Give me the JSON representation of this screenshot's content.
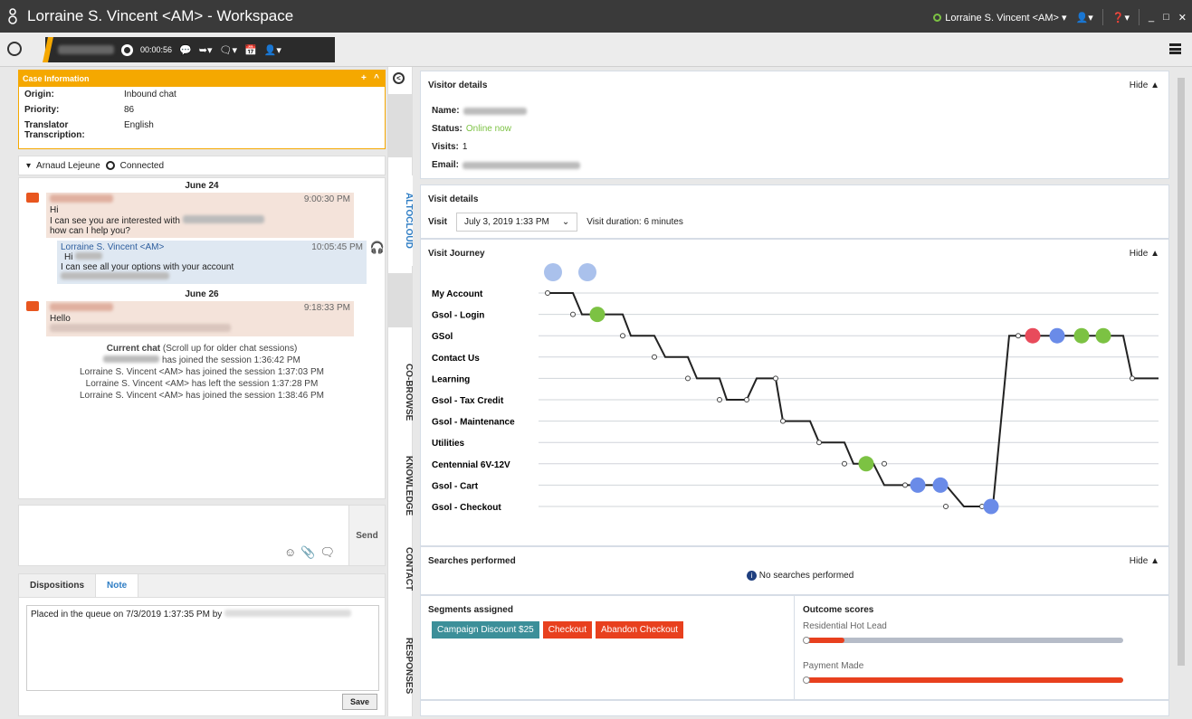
{
  "window": {
    "title": "Lorraine S. Vincent <AM> - Workspace",
    "user_status": "Lorraine S. Vincent <AM>"
  },
  "toolbar": {
    "timer": "00:00:56"
  },
  "case": {
    "header": "Case Information",
    "rows": [
      {
        "k": "Origin:",
        "v": "Inbound chat"
      },
      {
        "k": "Priority:",
        "v": "86"
      },
      {
        "k": "Translator Transcription:",
        "v": "English"
      }
    ]
  },
  "party": {
    "name": "Arnaud Lejeune",
    "status": "Connected"
  },
  "transcript": {
    "date1": "June 24",
    "m1": {
      "time": "9:00:30 PM",
      "l1": "Hi",
      "l2": "I can see you are interested with",
      "l3": "how can I help you?"
    },
    "m2": {
      "sender": "Lorraine S. Vincent <AM>",
      "time": "10:05:45 PM",
      "l1": "Hi",
      "l2": "I can see all your options with your account"
    },
    "date2": "June 26",
    "m3": {
      "time": "9:18:33 PM",
      "l1": "Hello"
    },
    "current_a": "Current chat",
    "current_b": " (Scroll up for older chat sessions)",
    "sys1": "has joined the session 1:36:42 PM",
    "sys2": "Lorraine S. Vincent <AM> has joined the session 1:37:03 PM",
    "sys3": "Lorraine S. Vincent <AM> has left the session 1:37:28 PM",
    "sys4": "Lorraine S. Vincent <AM> has joined the session 1:38:46 PM"
  },
  "compose": {
    "send": "Send"
  },
  "notes": {
    "tab1": "Dispositions",
    "tab2": "Note",
    "text": "Placed in the queue on 7/3/2019 1:37:35 PM by",
    "save": "Save"
  },
  "sidetabs": {
    "t1": "ALTOCLOUD",
    "t2": "CO-BROWSE",
    "t3": "KNOWLEDGE",
    "t4": "CONTACT",
    "t5": "RESPONSES"
  },
  "visitor": {
    "title": "Visitor details",
    "hide": "Hide",
    "name_k": "Name:",
    "status_k": "Status:",
    "status_v": "Online now",
    "visits_k": "Visits:",
    "visits_v": "1",
    "email_k": "Email:"
  },
  "visitdet": {
    "title": "Visit details",
    "visit_k": "Visit",
    "visit_v": "July 3, 2019 1:33 PM",
    "duration": "Visit duration: 6 minutes"
  },
  "journey": {
    "title": "Visit Journey",
    "hide": "Hide",
    "pages": [
      "My Account",
      "Gsol - Login",
      "GSol",
      "Contact Us",
      "Learning",
      "Gsol - Tax Credit",
      "Gsol - Maintenance",
      "Utilities",
      "Centennial 6V-12V",
      "Gsol - Cart",
      "Gsol - Checkout"
    ]
  },
  "searches": {
    "title": "Searches performed",
    "hide": "Hide",
    "empty": "No searches performed"
  },
  "segments": {
    "title": "Segments assigned",
    "items": [
      "Campaign Discount $25",
      "Checkout",
      "Abandon Checkout"
    ],
    "colors": [
      "#3c8f99",
      "#e8401e",
      "#e8401e"
    ]
  },
  "outcomes": {
    "title": "Outcome scores",
    "s1": "Residential Hot Lead",
    "s2": "Payment Made",
    "s1_level": 0.12,
    "s2_level": 1.0
  }
}
